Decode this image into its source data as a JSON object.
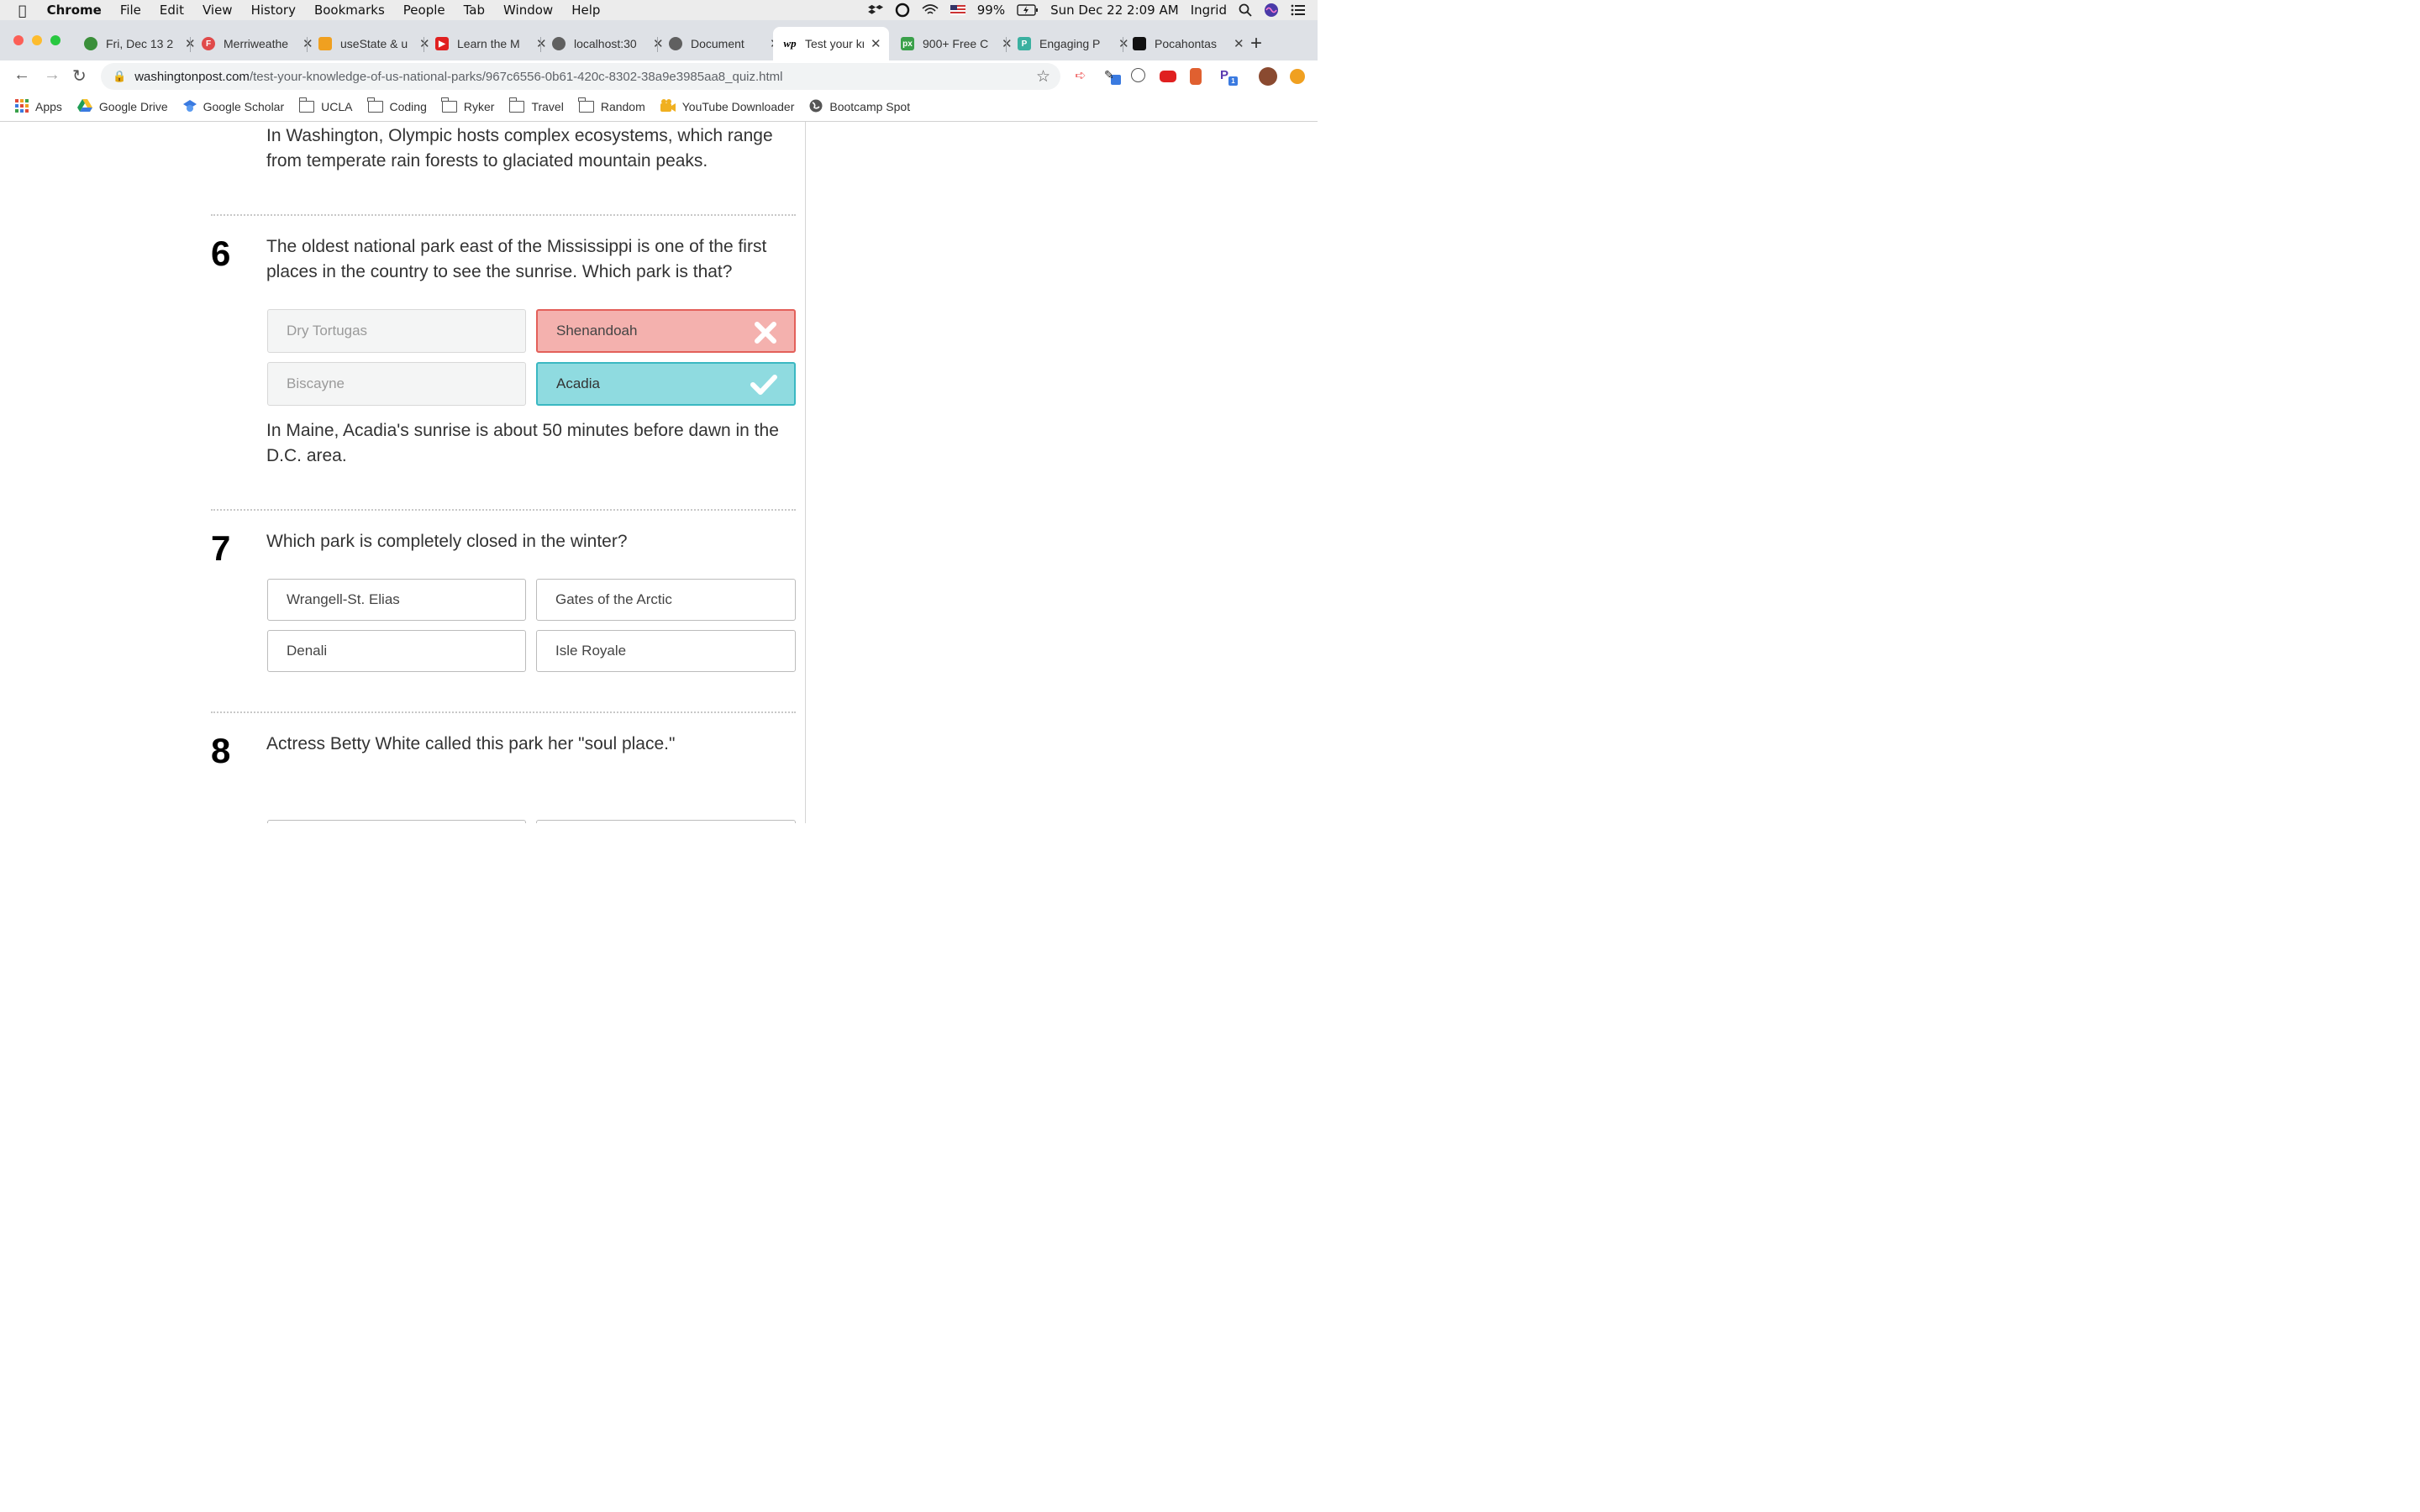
{
  "menubar": {
    "app": "Chrome",
    "menus": [
      "File",
      "Edit",
      "View",
      "History",
      "Bookmarks",
      "People",
      "Tab",
      "Window",
      "Help"
    ],
    "battery": "99%",
    "datetime": "Sun Dec 22  2:09 AM",
    "user": "Ingrid"
  },
  "tabs": [
    {
      "title": "Fri, Dec 13 2",
      "color": "#3a8f3a"
    },
    {
      "title": "Merriweathe",
      "color": "#e04a4a"
    },
    {
      "title": "useState & u",
      "color": "#f0a020"
    },
    {
      "title": "Learn the M",
      "color": "#e02020"
    },
    {
      "title": "localhost:30",
      "color": "#606060"
    },
    {
      "title": "Document",
      "color": "#606060"
    },
    {
      "title": "Test your kn",
      "color": "#000000"
    },
    {
      "title": "900+ Free C",
      "color": "#3aa04a"
    },
    {
      "title": "Engaging P",
      "color": "#3ab0a0"
    },
    {
      "title": "Pocahontas",
      "color": "#111111"
    }
  ],
  "url": {
    "host": "washingtonpost.com",
    "path": "/test-your-knowledge-of-us-national-parks/967c6556-0b61-420c-8302-38a9e3985aa8_quiz.html"
  },
  "bookmarks": [
    "Apps",
    "Google Drive",
    "Google Scholar",
    "UCLA",
    "Coding",
    "Ryker",
    "Travel",
    "Random",
    "YouTube Downloader",
    "Bootcamp Spot"
  ],
  "quiz": {
    "prev_explanation": "In Washington, Olympic hosts complex ecosystems, which range from temperate rain forests to glaciated mountain peaks.",
    "q6": {
      "number": "6",
      "question": "The oldest national park east of the Mississippi is one of the first places in the country to see the sunrise. Which park is that?",
      "answers": [
        "Dry Tortugas",
        "Shenandoah",
        "Biscayne",
        "Acadia"
      ],
      "explanation": "In Maine, Acadia's sunrise is about 50 minutes before dawn in the D.C. area."
    },
    "q7": {
      "number": "7",
      "question": "Which park is completely closed in the winter?",
      "answers": [
        "Wrangell-St. Elias",
        "Gates of the Arctic",
        "Denali",
        "Isle Royale"
      ]
    },
    "q8": {
      "number": "8",
      "question": "Actress Betty White called this park her \"soul place.\""
    }
  }
}
